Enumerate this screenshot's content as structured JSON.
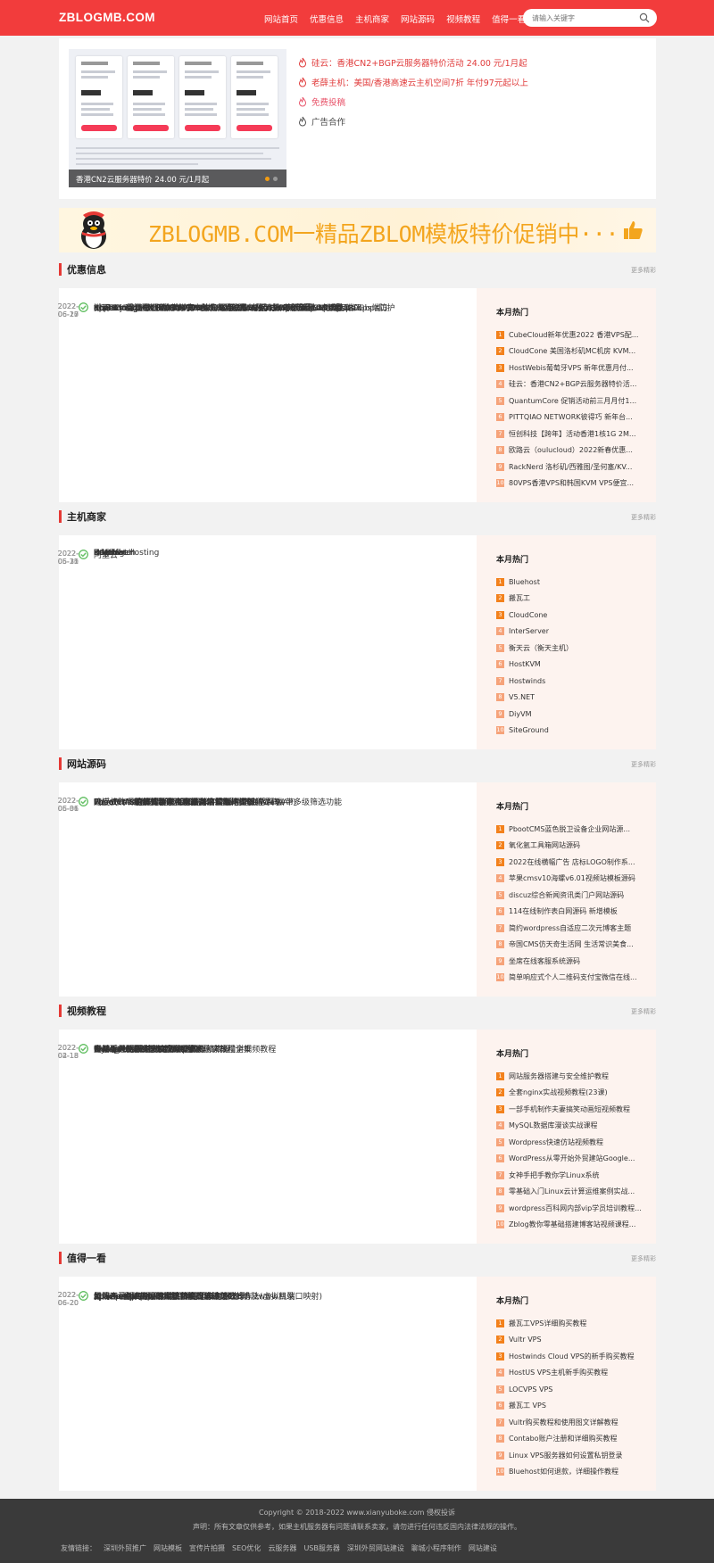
{
  "header": {
    "logo": "ZBLOGMB.COM",
    "nav": [
      "网站首页",
      "优惠信息",
      "主机商家",
      "网站源码",
      "视频教程",
      "值得一看"
    ],
    "search_placeholder": "请输入关键字"
  },
  "slider": {
    "caption": "香港CN2云服务器特价 24.00 元/1月起"
  },
  "top_links": [
    {
      "text": "硅云：香港CN2+BGP云服务器特价活动 24.00 元/1月起",
      "color": "red"
    },
    {
      "text": "老薛主机：美国/香港高速云主机空间7折 年付97元起以上",
      "color": "red"
    },
    {
      "text": "免费投稿",
      "color": "pink"
    },
    {
      "text": "广告合作",
      "color": "gray"
    }
  ],
  "banner": {
    "text": "ZBLOGMB.COM一精品ZBLOM模板特价促销中···"
  },
  "sections": [
    {
      "title": "优惠信息",
      "more": "更多精彩",
      "rows": [
        {
          "title": "BGPTO6月优惠：新加坡/日本独立服务器65折月付64美元起",
          "date": "2022-06-25"
        },
        {
          "title": "KcpCloud：香港CMI大带宽VPS 269元/月/2核/2GB内存/闲/5TB流量/1Gbps端口",
          "date": "2022-06-20"
        },
        {
          "title": "c1vhosting：欧洲KVM VPS €20/年/2GB/2TB流量/100Mbps 免费1180Gbps防护",
          "date": "2022-06-20"
        },
        {
          "title": "66.TO：芝加哥CN2 GIA VPS $9.4/月/2核/1.75GB/不限流量/100Mbps",
          "date": "2022-06-17"
        },
        {
          "title": "Kuai Che Dao：日本BGP VPS $29.59/半年/1GB//1TB流量/10Gbps端口",
          "date": "2022-06-17"
        },
        {
          "title": "SpeedyPage：纽约KVM VPS £2.1/月/1GB内存/1TB流量/1Gbps端口",
          "date": "2022-06-17"
        },
        {
          "title": "CubeCloud：618优惠2022 全场产品终身88折",
          "date": "2022-06-17"
        },
        {
          "title": "搬瓦工：香港CMI VPS年付74美元,单核/1G内存/1Gbps/三网CMI线路",
          "date": "2022-06-17"
        }
      ],
      "hot_title": "本月热门",
      "hot": [
        "CubeCloud新年优惠2022 香港VPS配...",
        "CloudCone 美国洛杉矶MC机房 KVM...",
        "HostWebis葡萄牙VPS 新年优惠月付...",
        "硅云：香港CN2+BGP云服务器特价活...",
        "QuantumCore 促销活动前三月月付1...",
        "PITTQIAO NETWORK彼得巧 新年台...",
        "恒创科技【跨年】活动香港1核1G 2M...",
        "欧路云（oulucloud）2022新春优惠...",
        "RackNerd 洛杉矶/西雅图/圣何塞/KV...",
        "80VPS香港VPS和韩国KVM VPS便宜..."
      ]
    },
    {
      "title": "主机商家",
      "more": "更多精彩",
      "rows": [
        {
          "title": "BGPTO",
          "date": "2022-06-25"
        },
        {
          "title": "Edgevirt",
          "date": "2022-06-10"
        },
        {
          "title": "Krypt",
          "date": "2022-05-31"
        },
        {
          "title": "Hetzner",
          "date": "2022-05-31"
        },
        {
          "title": "Hostinger",
          "date": "2022-05-31"
        },
        {
          "title": "阿里云",
          "date": "2022-05-31"
        },
        {
          "title": "HostHatch",
          "date": "2022-05-31"
        },
        {
          "title": "InMotionHosting",
          "date": "2022-05-31"
        }
      ],
      "hot_title": "本月热门",
      "hot": [
        "Bluehost",
        "搬瓦工",
        "CloudCone",
        "InterServer",
        "衡天云（衡天主机）",
        "HostKVM",
        "Hostwinds",
        "V5.NET",
        "DiyVM",
        "SiteGround"
      ]
    },
    {
      "title": "网站源码",
      "more": "更多精彩",
      "rows": [
        {
          "title": "PbootCMS响应式留学咨询教育培训机构类网站源码+带多级筛选功能",
          "date": "2022-06-06"
        },
        {
          "title": "PbootCMS营销型小家电电器类网站源码(PC+WAP)",
          "date": "2022-06-06"
        },
        {
          "title": "PbootCMS家纺针织床上用品类企业网站源码(PC+WAP)",
          "date": "2022-06-06"
        },
        {
          "title": "PbootCMS响应式精密仪器设备公司网站模板",
          "date": "2022-06-06"
        },
        {
          "title": "PbootCMS新媒体新闻资讯类网站模板(自适应手机端)",
          "date": "2022-06-06"
        },
        {
          "title": "响应式HTML静态导航网源码",
          "date": "2022-06-06"
        },
        {
          "title": "WordPress自适应无刷新加载博客模板",
          "date": "2022-05-31"
        },
        {
          "title": "无授权购啊购云购源码/带机器人+控制附带教程",
          "date": "2022-05-31"
        }
      ],
      "hot_title": "本月热门",
      "hot": [
        "PbootCMS蓝色脱卫设备企业网站源...",
        "氧化氩工具箱网站源码",
        "2022在线横幅广告 店标LOGO制作系...",
        "苹果cmsv10海螺v6.01视频站模板源码",
        "discuz综合新闻资讯类门户网站源码",
        "114在线制作表白网源码 新增模板",
        "简约wordpress自适应二次元博客主题",
        "帝国CMS仿天奇生活网 生活常识美食...",
        "坐席在线客服系统源码",
        "简单响应式个人二维码支付宝微信在线..."
      ]
    },
    {
      "title": "视频教程",
      "more": "更多精彩",
      "rows": [
        {
          "title": "一部手机制作夫妻搞笑动画短视频教程",
          "date": "2022-04-15"
        },
        {
          "title": "MySQL数据库漫谈实战课程",
          "date": "2022-02-18"
        },
        {
          "title": "女神手把手教你学Linux系统",
          "date": "2022-02-18"
        },
        {
          "title": "全套nginx实战视频教程(23课)",
          "date": "2022-02-18"
        },
        {
          "title": "网站服务器搭建与安全维护教程",
          "date": "2022-02-18"
        },
        {
          "title": "零基础入门Linux云计算运维案例实战精讲视频教程",
          "date": "2022-02-18"
        },
        {
          "title": "Wordpress快速仿站视频教程",
          "date": "2022-02-18"
        },
        {
          "title": "wordpress百科网内部vip学员培训教程全集",
          "date": "2022-02-18"
        }
      ],
      "hot_title": "本月热门",
      "hot": [
        "网站服务器搭建与安全维护教程",
        "全套nginx实战视频教程(23课)",
        "一部手机制作夫妻搞笑动画短视频教程",
        "MySQL数据库漫谈实战课程",
        "Wordpress快速仿站视频教程",
        "WordPress从零开始外贸建站Google...",
        "女神手把手教你学Linux系统",
        "零基础入门Linux云计算运维案例实战...",
        "wordpress百科网内部vip学员培训教程...",
        "Zblog教你零基础搭建博客站视频课程..."
      ]
    },
    {
      "title": "值得一看",
      "more": "更多精彩",
      "rows": [
        {
          "title": "修改wamp的apache默认端口80为8088以及www目录",
          "date": "2022-06-20"
        },
        {
          "title": "apache+php上传大文件以上传100M为例",
          "date": "2022-06-20"
        },
        {
          "title": "apache和IIS共享80端口解决办法",
          "date": "2022-06-20"
        },
        {
          "title": "关闭Apache的目录浏览功能的方法",
          "date": "2022-06-20"
        },
        {
          "title": "Apache中如何设置默认首页具体该怎么操作",
          "date": "2022-06-20"
        },
        {
          "title": "apache虚拟机配置步骤和修改访问端口的方法(虚拟机端口映射)",
          "date": "2022-06-20"
        },
        {
          "title": "影响网站服务器租用稳定性的因素有哪些",
          "date": "2022-06-20"
        },
        {
          "title": "如何查看Apache的连接数和当前连接数",
          "date": "2022-06-20"
        }
      ],
      "hot_title": "本月热门",
      "hot": [
        "搬瓦工VPS详细购买教程",
        "Vultr VPS",
        "Hostwinds Cloud VPS的新手购买教程",
        "HostUS VPS主机新手购买教程",
        "LOCVPS VPS",
        "搬瓦工 VPS",
        "Vultr购买教程和使用图文详解教程",
        "Contabo账户注册和详细购买教程",
        "Linux VPS服务器如何设置私钥登录",
        "Bluehost如何退款，详细操作教程"
      ]
    }
  ],
  "footer": {
    "copyright": "Copyright © 2018-2022 www.xianyuboke.com 侵权投诉",
    "notice": "声明：所有文章仅供参考，如果主机服务器有问题请联系卖家，请勿进行任何违反国内法律法规的操作。",
    "links_label": "友情链接：",
    "links": [
      "深圳外贸推广",
      "网站模板",
      "宣传片拍摄",
      "SEO优化",
      "云服务器",
      "USB服务器",
      "深圳外贸网站建设",
      "聊城小程序制作",
      "网站建设"
    ]
  },
  "colors": {
    "accent": "#f23c3c",
    "hot_rank_top": "#f3811c",
    "hot_rank_rest": "#f6a37a",
    "check": "#6ac26a"
  },
  "icons": {
    "search": "search-icon",
    "fire": "fire-icon",
    "check": "check-circle-icon",
    "thumb": "thumbs-up-icon",
    "mascot": "penguin-mascot-icon"
  }
}
